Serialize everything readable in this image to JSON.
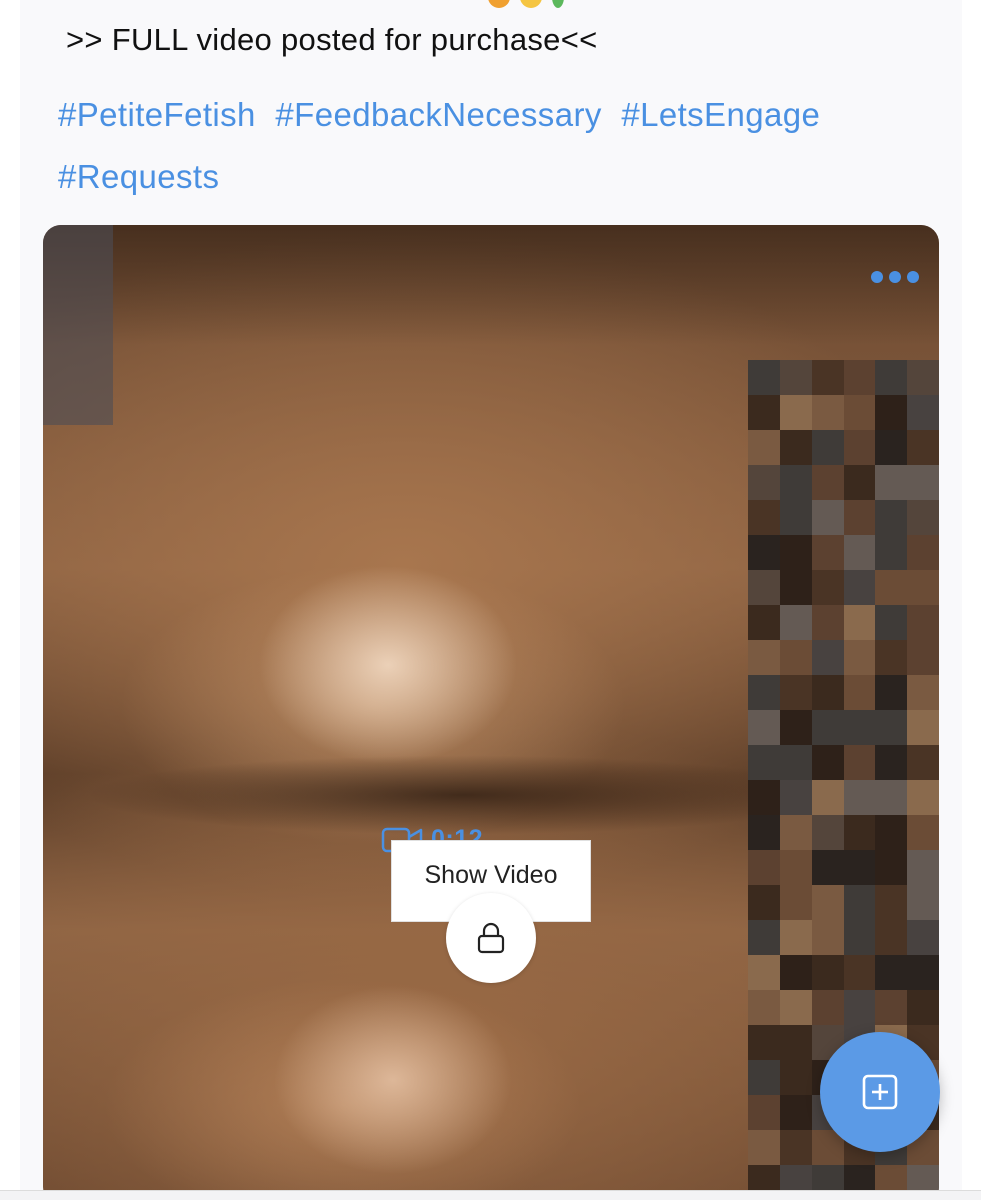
{
  "post": {
    "caption": ">> FULL video posted for purchase<<",
    "hashtags": [
      "#PetiteFetish",
      "#FeedbackNecessary",
      "#LetsEngage",
      "#Requests"
    ],
    "emoji_colors": [
      "#f0a030",
      "#f5c542",
      "#5cb85c"
    ]
  },
  "media": {
    "duration": "0:12",
    "show_label": "Show Video",
    "more_icon": "more-horizontal-icon",
    "lock_icon": "lock-icon",
    "video_icon": "video-camera-icon"
  },
  "fab": {
    "icon": "add-post-icon"
  },
  "colors": {
    "accent": "#4a90e2",
    "fab": "#5b9ae6"
  }
}
